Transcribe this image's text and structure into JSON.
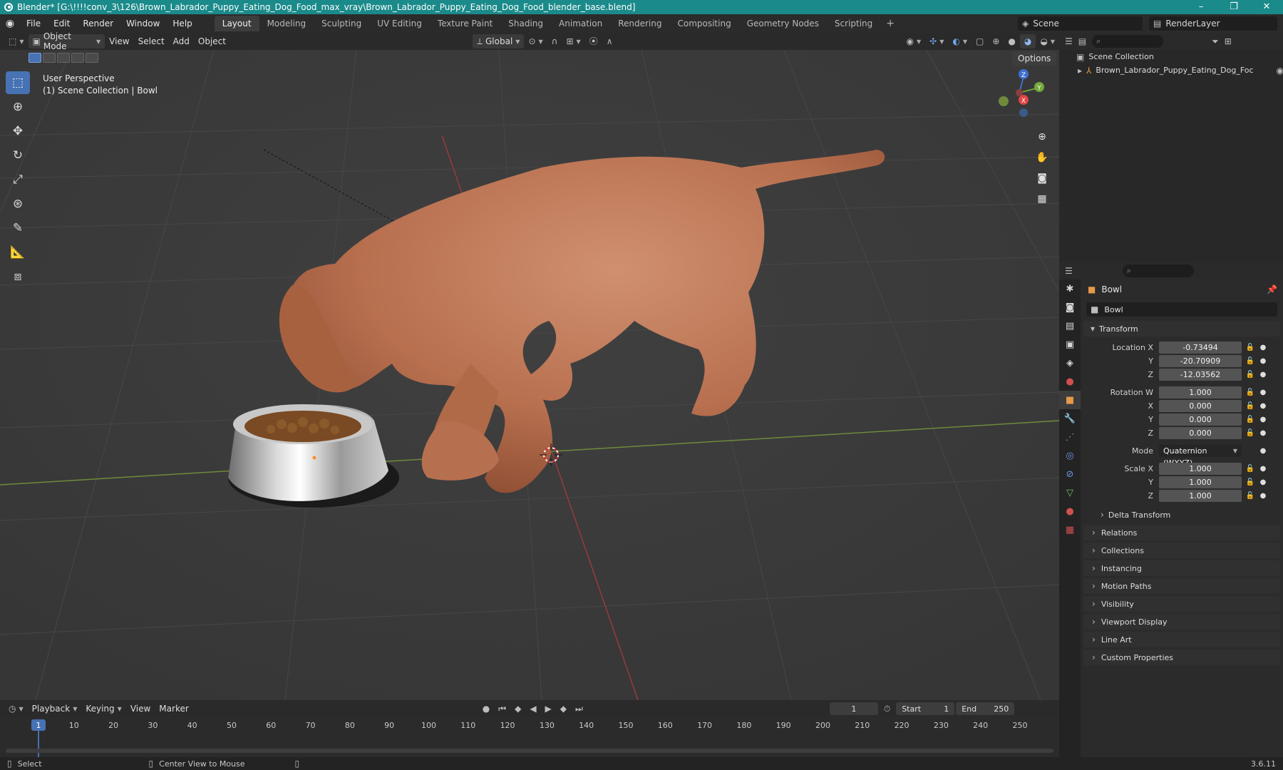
{
  "window": {
    "title": "Blender* [G:\\!!!!conv_3\\126\\Brown_Labrador_Puppy_Eating_Dog_Food_max_vray\\Brown_Labrador_Puppy_Eating_Dog_Food_blender_base.blend]",
    "controls": [
      "–",
      "❐",
      "✕"
    ]
  },
  "menu": [
    "File",
    "Edit",
    "Render",
    "Window",
    "Help"
  ],
  "workspaces": {
    "tabs": [
      "Layout",
      "Modeling",
      "Sculpting",
      "UV Editing",
      "Texture Paint",
      "Shading",
      "Animation",
      "Rendering",
      "Compositing",
      "Geometry Nodes",
      "Scripting"
    ],
    "active": "Layout",
    "add": "+"
  },
  "scene": {
    "name": "Scene"
  },
  "render_layer": {
    "name": "RenderLayer"
  },
  "viewport": {
    "mode": "Object Mode",
    "menus": [
      "View",
      "Select",
      "Add",
      "Object"
    ],
    "transform_orientation": "Global",
    "options_label": "Options",
    "info_line1": "User Perspective",
    "info_line2": "(1) Scene Collection | Bowl",
    "gizmo_axes": [
      "Z",
      "Y",
      "X"
    ]
  },
  "outliner": {
    "search_placeholder": "",
    "root": "Scene Collection",
    "items": [
      {
        "name": "Brown_Labrador_Puppy_Eating_Dog_Foc"
      }
    ]
  },
  "properties": {
    "object_name": "Bowl",
    "data_name": "Bowl",
    "transform_title": "Transform",
    "location": {
      "label": "Location X",
      "x": "-0.73494",
      "y": "-20.70909",
      "z": "-12.03562"
    },
    "rotation": {
      "label": "Rotation W",
      "w": "1.000",
      "x": "0.000",
      "y": "0.000",
      "z": "0.000"
    },
    "mode": {
      "label": "Mode",
      "value": "Quaternion (WXYZ)"
    },
    "scale": {
      "label": "Scale X",
      "x": "1.000",
      "y": "1.000",
      "z": "1.000"
    },
    "axis_labels": {
      "y": "Y",
      "z": "Z",
      "x": "X"
    },
    "delta_transform": "Delta Transform",
    "panels": [
      "Relations",
      "Collections",
      "Instancing",
      "Motion Paths",
      "Visibility",
      "Viewport Display",
      "Line Art",
      "Custom Properties"
    ]
  },
  "timeline": {
    "menus": [
      "Playback",
      "Keying",
      "View",
      "Marker"
    ],
    "current_frame": "1",
    "start_label": "Start",
    "start": "1",
    "end_label": "End",
    "end": "250",
    "ruler": [
      "1",
      "10",
      "20",
      "30",
      "40",
      "50",
      "60",
      "70",
      "80",
      "90",
      "100",
      "110",
      "120",
      "130",
      "140",
      "150",
      "160",
      "170",
      "180",
      "190",
      "200",
      "210",
      "220",
      "230",
      "240",
      "250"
    ]
  },
  "status": {
    "select": "Select",
    "center_view": "Center View to Mouse",
    "version": "3.6.11"
  }
}
